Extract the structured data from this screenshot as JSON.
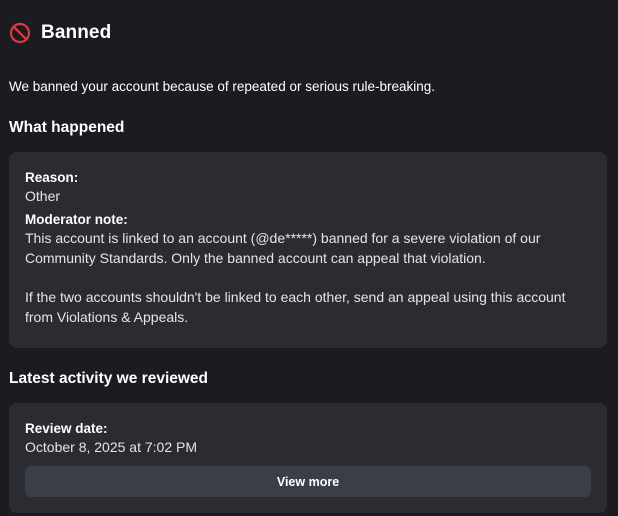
{
  "header": {
    "icon": "ban-icon",
    "title": "Banned",
    "accent_color": "#e0393e"
  },
  "intro": "We banned your account because of repeated or serious rule-breaking.",
  "what_happened": {
    "heading": "What happened",
    "reason_label": "Reason:",
    "reason_value": "Other",
    "note_label": "Moderator note:",
    "note_paragraphs": [
      "This account is linked to an account (@de*****) banned for a severe violation of our Community Standards. Only the banned account can appeal that violation.",
      "If the two accounts shouldn't be linked to each other, send an appeal using this account from Violations & Appeals."
    ]
  },
  "latest_activity": {
    "heading": "Latest activity we reviewed",
    "review_date_label": "Review date:",
    "review_date_value": "October 8, 2025 at 7:02 PM",
    "view_more_label": "View more"
  }
}
